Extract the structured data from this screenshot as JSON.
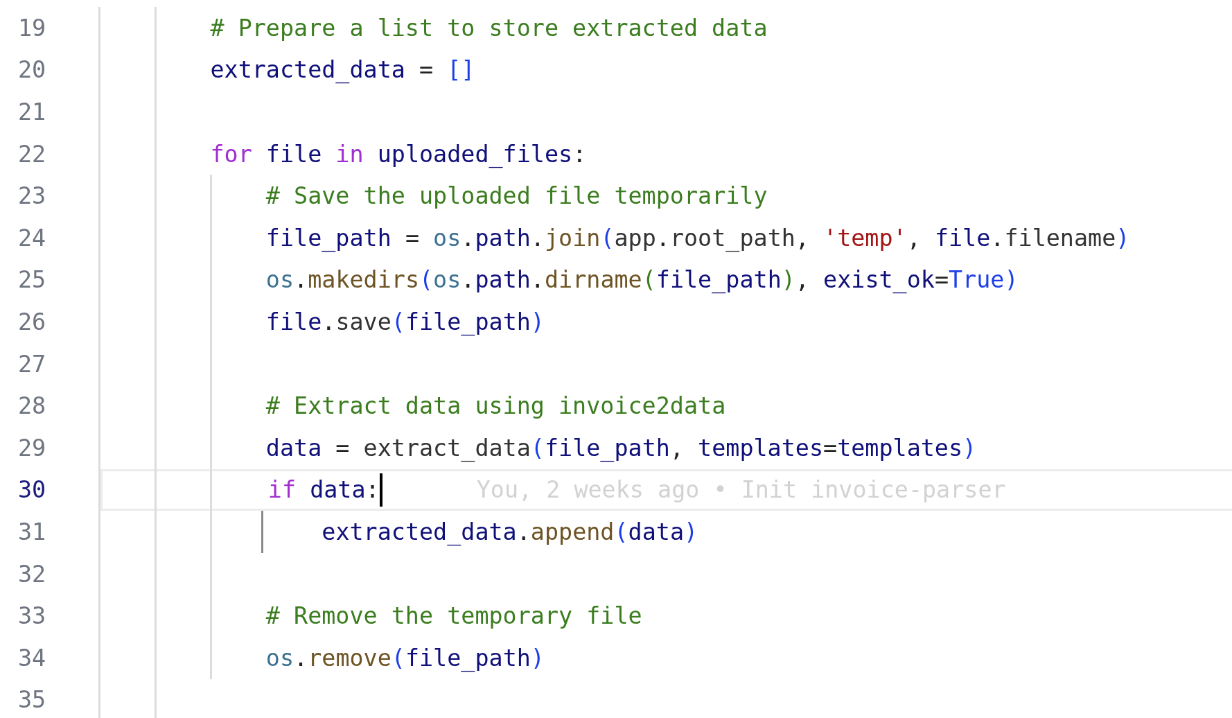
{
  "editor": {
    "lines": [
      {
        "number": "19",
        "current": false,
        "tokens": [
          {
            "text": "# Prepare a list to store extracted data",
            "kind": "comment"
          }
        ]
      },
      {
        "number": "20",
        "current": false,
        "tokens": [
          {
            "text": "extracted_data",
            "kind": "id"
          },
          {
            "text": " = ",
            "kind": "op"
          },
          {
            "text": "[]",
            "kind": "bracket"
          }
        ]
      },
      {
        "number": "21",
        "current": false
      },
      {
        "number": "22",
        "current": false,
        "tokens": [
          {
            "text": "for",
            "kind": "keyword"
          },
          {
            "text": " file ",
            "kind": "id"
          },
          {
            "text": "in",
            "kind": "keyword"
          },
          {
            "text": " uploaded_files",
            "kind": "id"
          },
          {
            "text": ":",
            "kind": "op"
          }
        ],
        "children": [
          {
            "number": "23",
            "current": false,
            "tokens": [
              {
                "text": "# Save the uploaded file temporarily",
                "kind": "comment"
              }
            ]
          },
          {
            "number": "24",
            "current": false,
            "tokens": [
              {
                "text": "file_path",
                "kind": "id"
              },
              {
                "text": " = ",
                "kind": "op"
              },
              {
                "text": "os",
                "kind": "module"
              },
              {
                "text": ".",
                "kind": "op"
              },
              {
                "text": "path",
                "kind": "id"
              },
              {
                "text": ".",
                "kind": "op"
              },
              {
                "text": "join",
                "kind": "function"
              },
              {
                "text": "(",
                "kind": "bracket"
              },
              {
                "text": "app",
                "kind": "attr"
              },
              {
                "text": ".",
                "kind": "op"
              },
              {
                "text": "root_path",
                "kind": "attr"
              },
              {
                "text": ", ",
                "kind": "op"
              },
              {
                "text": "'temp'",
                "kind": "string"
              },
              {
                "text": ", ",
                "kind": "op"
              },
              {
                "text": "file",
                "kind": "id"
              },
              {
                "text": ".",
                "kind": "op"
              },
              {
                "text": "filename",
                "kind": "attr"
              },
              {
                "text": ")",
                "kind": "bracket"
              }
            ]
          },
          {
            "number": "25",
            "current": false,
            "tokens": [
              {
                "text": "os",
                "kind": "module"
              },
              {
                "text": ".",
                "kind": "op"
              },
              {
                "text": "makedirs",
                "kind": "function"
              },
              {
                "text": "(",
                "kind": "bracket"
              },
              {
                "text": "os",
                "kind": "module"
              },
              {
                "text": ".",
                "kind": "op"
              },
              {
                "text": "path",
                "kind": "id"
              },
              {
                "text": ".",
                "kind": "op"
              },
              {
                "text": "dirname",
                "kind": "function"
              },
              {
                "text": "(",
                "kind": "bracket2"
              },
              {
                "text": "file_path",
                "kind": "id"
              },
              {
                "text": ")",
                "kind": "bracket2"
              },
              {
                "text": ", ",
                "kind": "op"
              },
              {
                "text": "exist_ok",
                "kind": "id"
              },
              {
                "text": "=",
                "kind": "op"
              },
              {
                "text": "True",
                "kind": "constant"
              },
              {
                "text": ")",
                "kind": "bracket"
              }
            ]
          },
          {
            "number": "26",
            "current": false,
            "tokens": [
              {
                "text": "file",
                "kind": "id"
              },
              {
                "text": ".",
                "kind": "op"
              },
              {
                "text": "save",
                "kind": "attr"
              },
              {
                "text": "(",
                "kind": "bracket"
              },
              {
                "text": "file_path",
                "kind": "id"
              },
              {
                "text": ")",
                "kind": "bracket"
              }
            ]
          },
          {
            "number": "27",
            "current": false
          },
          {
            "number": "28",
            "current": false,
            "tokens": [
              {
                "text": "# Extract data using invoice2data",
                "kind": "comment"
              }
            ]
          },
          {
            "number": "29",
            "current": false,
            "tokens": [
              {
                "text": "data",
                "kind": "id"
              },
              {
                "text": " = ",
                "kind": "op"
              },
              {
                "text": "extract_data",
                "kind": "attr"
              },
              {
                "text": "(",
                "kind": "bracket"
              },
              {
                "text": "file_path",
                "kind": "id"
              },
              {
                "text": ", ",
                "kind": "op"
              },
              {
                "text": "templates",
                "kind": "id"
              },
              {
                "text": "=",
                "kind": "op"
              },
              {
                "text": "templates",
                "kind": "id"
              },
              {
                "text": ")",
                "kind": "bracket"
              }
            ]
          },
          {
            "number": "30",
            "current": true,
            "tokens": [
              {
                "text": "if",
                "kind": "keyword"
              },
              {
                "text": " data",
                "kind": "id"
              },
              {
                "text": ":",
                "kind": "op"
              }
            ],
            "blame": "You, 2 weeks ago • Init invoice-parser",
            "children": [
              {
                "number": "31",
                "current": false,
                "tokens": [
                  {
                    "text": "extracted_data",
                    "kind": "id"
                  },
                  {
                    "text": ".",
                    "kind": "op"
                  },
                  {
                    "text": "append",
                    "kind": "function"
                  },
                  {
                    "text": "(",
                    "kind": "bracket"
                  },
                  {
                    "text": "data",
                    "kind": "id"
                  },
                  {
                    "text": ")",
                    "kind": "bracket"
                  }
                ]
              }
            ]
          },
          {
            "number": "32",
            "current": false
          },
          {
            "number": "33",
            "current": false,
            "tokens": [
              {
                "text": "# Remove the temporary file",
                "kind": "comment"
              }
            ]
          },
          {
            "number": "34",
            "current": false,
            "tokens": [
              {
                "text": "os",
                "kind": "module"
              },
              {
                "text": ".",
                "kind": "op"
              },
              {
                "text": "remove",
                "kind": "function"
              },
              {
                "text": "(",
                "kind": "bracket"
              },
              {
                "text": "file_path",
                "kind": "id"
              },
              {
                "text": ")",
                "kind": "bracket"
              }
            ]
          }
        ]
      },
      {
        "number": "35",
        "current": false
      }
    ]
  }
}
